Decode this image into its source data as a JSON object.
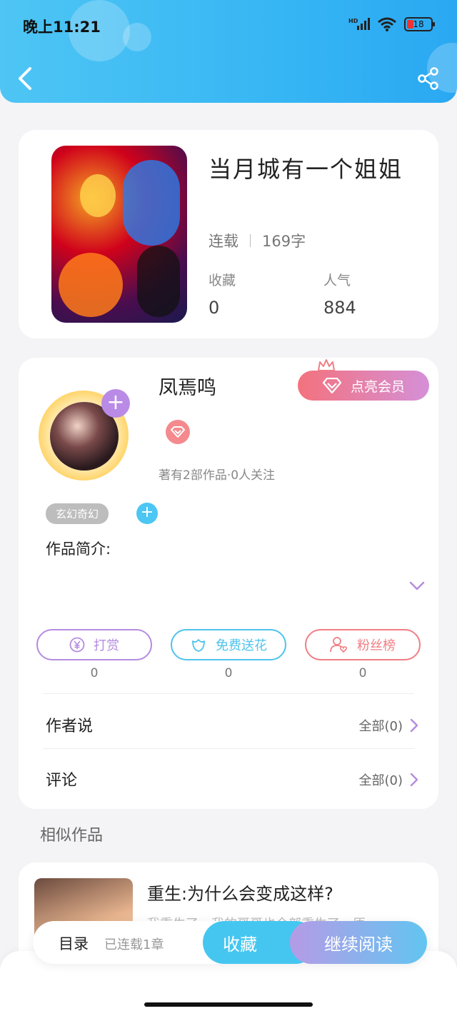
{
  "status_bar": {
    "time": "晚上11:21",
    "battery": "18"
  },
  "book": {
    "title": "当月城有一个姐姐",
    "status": "连载",
    "word_count": "169字",
    "stats": [
      {
        "label": "收藏",
        "value": "0"
      },
      {
        "label": "人气",
        "value": "884"
      }
    ]
  },
  "author": {
    "name": "凤焉鸣",
    "vip_button": "点亮会员",
    "works_info": "著有2部作品·0人关注",
    "tag": "玄幻奇幻",
    "intro_label": "作品简介:"
  },
  "actions": [
    {
      "label": "打赏",
      "count": "0",
      "color": "#b48ce0"
    },
    {
      "label": "免费送花",
      "count": "0",
      "color": "#4fc3ec"
    },
    {
      "label": "粉丝榜",
      "count": "0",
      "color": "#f07e84"
    }
  ],
  "rows": {
    "author_says": {
      "label": "作者说",
      "right": "全部(0)"
    },
    "comments": {
      "label": "评论",
      "right": "全部(0)"
    }
  },
  "similar": {
    "section_title": "相似作品",
    "title": "重生:为什么会变成这样?",
    "desc": "我重生了，我的哥哥也全部重生了，原"
  },
  "bottom_bar": {
    "toc": "目录",
    "toc_sub": "已连载1章",
    "favorite": "收藏",
    "continue_read": "继续阅读"
  }
}
